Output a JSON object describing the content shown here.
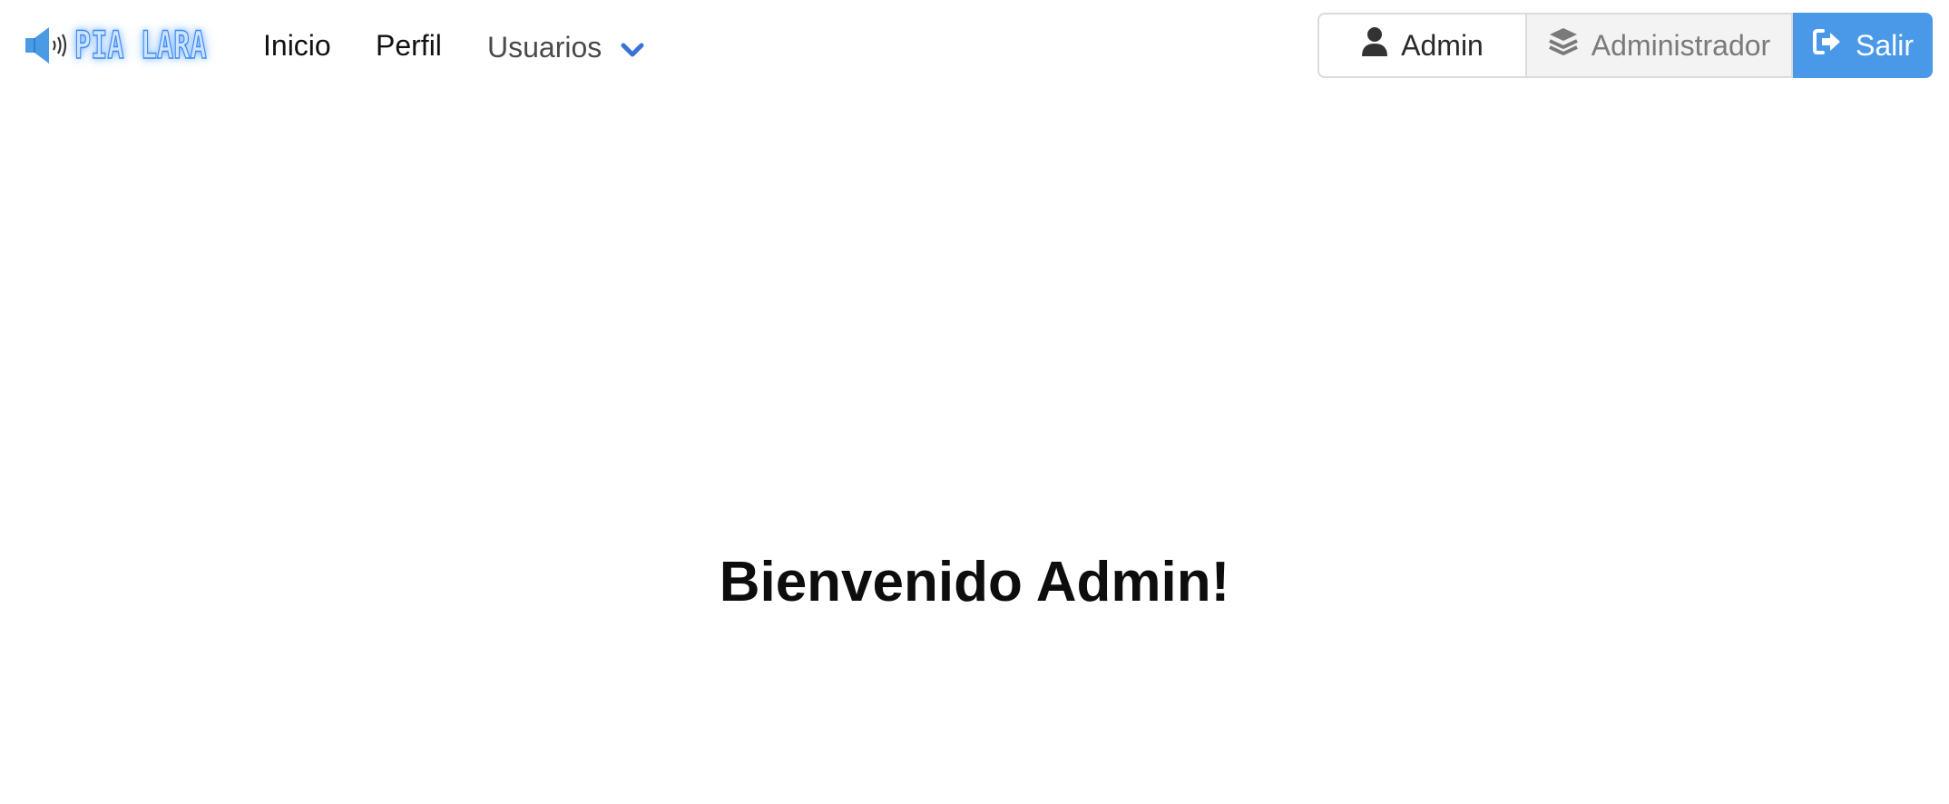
{
  "brand": {
    "name": "PIA LARA",
    "icon": "megaphone-speaker-icon"
  },
  "nav": {
    "items": [
      {
        "label": "Inicio"
      },
      {
        "label": "Perfil"
      },
      {
        "label": "Usuarios",
        "icon": "chevron-down-icon"
      }
    ]
  },
  "user_menu": {
    "user_label": "Admin",
    "user_icon": "user-icon",
    "role_label": "Administrador",
    "role_icon": "layers-icon",
    "logout_label": "Salir",
    "logout_icon": "sign-out-icon"
  },
  "main": {
    "welcome": "Bienvenido Admin!"
  },
  "colors": {
    "accent": "#4a99e9",
    "chevron": "#3a73d6",
    "role_bg": "#f3f3f3"
  }
}
